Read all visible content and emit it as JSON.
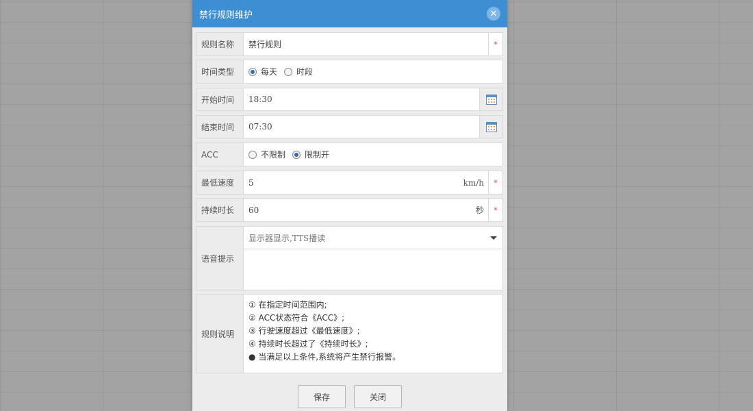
{
  "dialog": {
    "title": "禁行规则维护",
    "close_glyph": "✕"
  },
  "form": {
    "rule_name": {
      "label": "规则名称",
      "value": "禁行规则",
      "required": "*"
    },
    "time_type": {
      "label": "时间类型",
      "options": [
        {
          "label": "每天",
          "checked": true
        },
        {
          "label": "时段",
          "checked": false
        }
      ]
    },
    "start_time": {
      "label": "开始时间",
      "value": "18:30"
    },
    "end_time": {
      "label": "结束时间",
      "value": "07:30"
    },
    "acc": {
      "label": "ACC",
      "options": [
        {
          "label": "不限制",
          "checked": false
        },
        {
          "label": "限制开",
          "checked": true
        }
      ]
    },
    "min_speed": {
      "label": "最低速度",
      "value": "5",
      "unit": "km/h",
      "required": "*"
    },
    "duration": {
      "label": "持续时长",
      "value": "60",
      "unit": "秒",
      "required": "*"
    },
    "voice": {
      "label": "语音提示",
      "selected": "显示器显示,TTS播读",
      "text": ""
    },
    "description": {
      "label": "规则说明",
      "lines": [
        "① 在指定时间范围内;",
        "② ACC状态符合《ACC》;",
        "③ 行驶速度超过《最低速度》;",
        "④ 持续时长超过了《持续时长》;",
        "● 当满足以上条件,系统将产生禁行报警。"
      ]
    }
  },
  "footer": {
    "save_label": "保存",
    "close_label": "关闭"
  },
  "colors": {
    "header": "#3d8ed3",
    "required": "#e15a4a",
    "radio_on": "#2d6fb0"
  },
  "icons": {
    "calendar": "calendar-icon",
    "dropdown": "chevron-down-icon",
    "close": "close-icon"
  }
}
